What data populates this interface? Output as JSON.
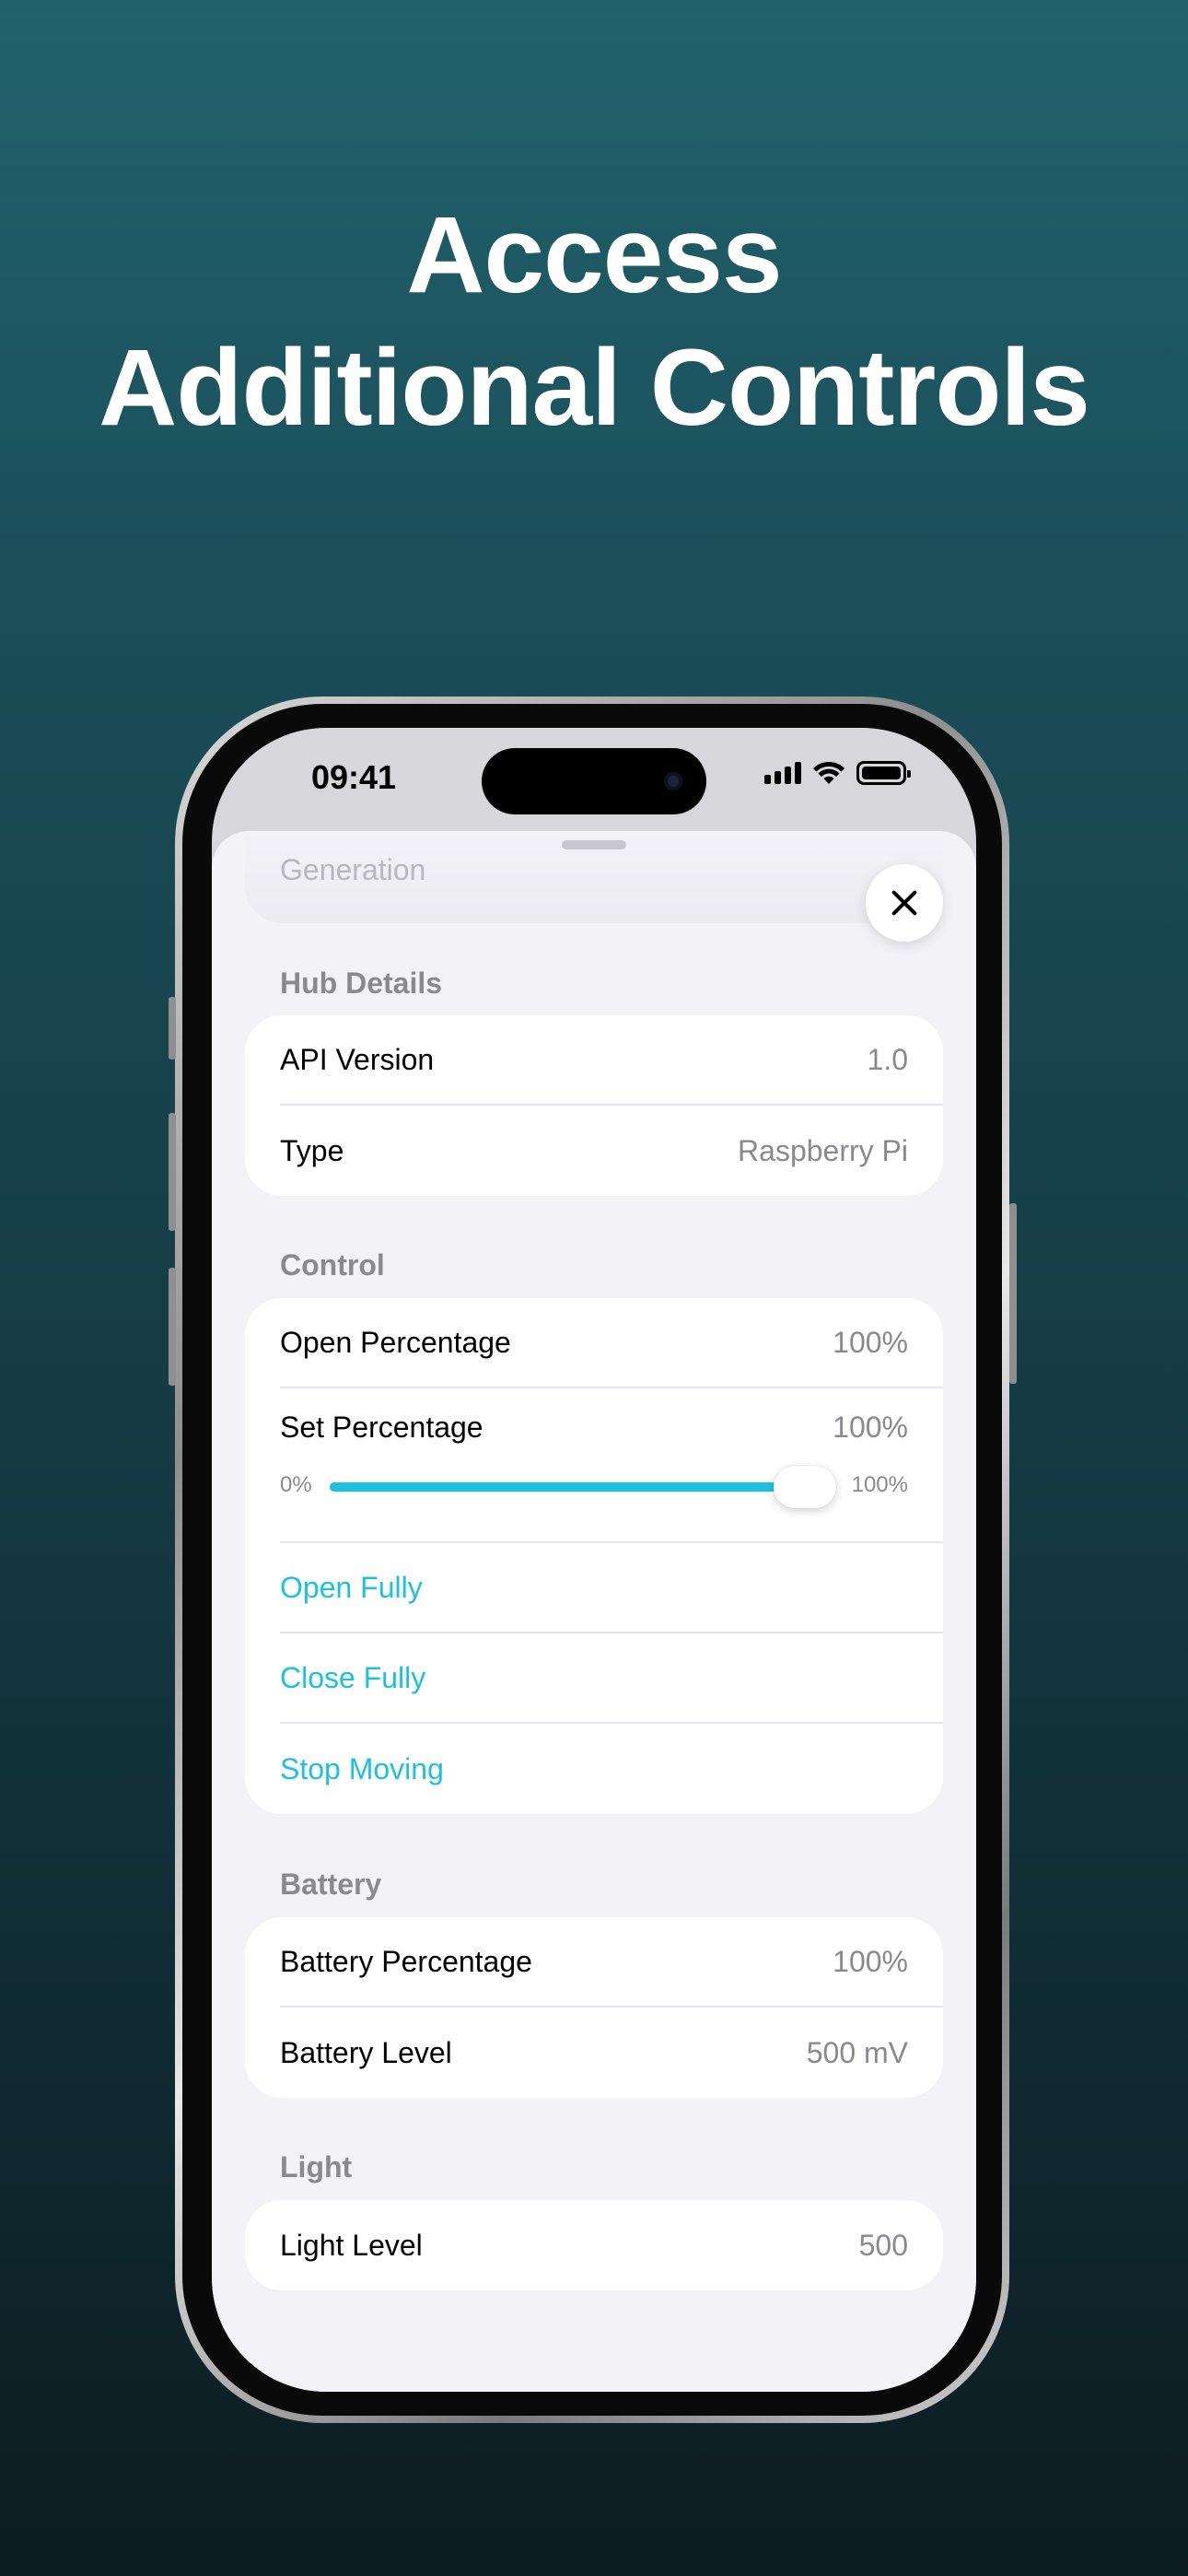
{
  "headline": {
    "line1": "Access",
    "line2": "Additional Controls"
  },
  "status_bar": {
    "time": "09:41"
  },
  "sheet": {
    "faded_row_label": "Generation",
    "close_icon": "xmark-icon"
  },
  "sections": {
    "hub_details": {
      "title": "Hub Details",
      "rows": [
        {
          "label": "API Version",
          "value": "1.0"
        },
        {
          "label": "Type",
          "value": "Raspberry Pi"
        }
      ]
    },
    "control": {
      "title": "Control",
      "open_percentage": {
        "label": "Open Percentage",
        "value": "100%"
      },
      "set_percentage": {
        "label": "Set Percentage",
        "value": "100%",
        "min_label": "0%",
        "max_label": "100%",
        "level": 1.0
      },
      "actions": [
        "Open Fully",
        "Close Fully",
        "Stop Moving"
      ]
    },
    "battery": {
      "title": "Battery",
      "rows": [
        {
          "label": "Battery Percentage",
          "value": "100%"
        },
        {
          "label": "Battery Level",
          "value": "500 mV"
        }
      ]
    },
    "light": {
      "title": "Light",
      "rows": [
        {
          "label": "Light Level",
          "value": "500"
        }
      ]
    }
  },
  "colors": {
    "accent": "#1ec0e0",
    "background_top": "#21626c",
    "background_bottom": "#0c1c21"
  }
}
